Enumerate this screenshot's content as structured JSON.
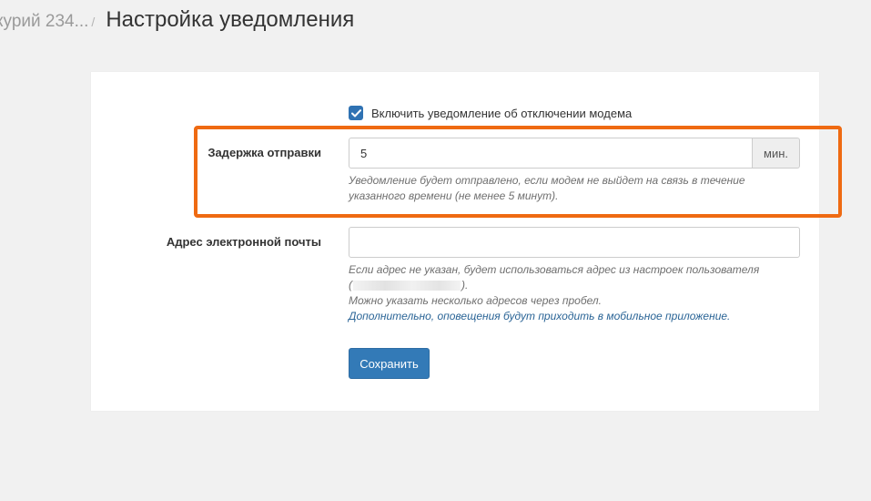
{
  "header": {
    "breadcrumb": "курий 234...",
    "separator": "/",
    "title": "Настройка уведомления"
  },
  "form": {
    "enable_checkbox": {
      "label": "Включить уведомление об отключении модема",
      "checked": true
    },
    "delay": {
      "label": "Задержка отправки",
      "value": "5",
      "unit": "мин.",
      "help": "Уведомление будет отправлено, если модем не выйдет на связь в течение указанного времени (не менее 5 минут)."
    },
    "email": {
      "label": "Адрес электронной почты",
      "value": "",
      "placeholder": "",
      "help_line1": "Если адрес не указан, будет использоваться адрес из настроек пользователя",
      "help_paren_open": "(",
      "help_paren_close": ").",
      "help_line3": "Можно указать несколько адресов через пробел.",
      "help_link": "Дополнительно, оповещения будут приходить в мобильное приложение."
    },
    "save_label": "Сохранить"
  },
  "colors": {
    "accent": "#337ab7",
    "highlight": "#ef6a12"
  }
}
